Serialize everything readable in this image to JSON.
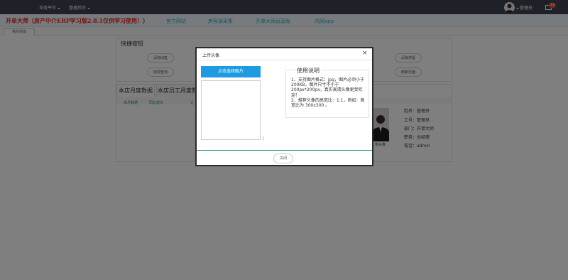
{
  "topbar": {
    "menu": [
      {
        "label": "业务平台"
      },
      {
        "label": "管理后台"
      }
    ],
    "user_name": "管理员",
    "mail_badge": "11"
  },
  "header": {
    "brand": "开单大师（房产中介ERP学习版2.8.1仅供学习使用！）",
    "links": [
      {
        "label": "官方网站"
      },
      {
        "label": "房客源采集"
      },
      {
        "label": "开单大师运营版"
      },
      {
        "label": "内网app"
      }
    ]
  },
  "tabs": {
    "active": "我的桌面"
  },
  "dashboard": {
    "quick_title": "快捷按钮",
    "quick_buttons": [
      {
        "label": "添加出售"
      },
      {
        "label": "房源查询"
      },
      {
        "label": "添加求租"
      },
      {
        "label": "刷新页面"
      }
    ],
    "data_tabs": [
      {
        "label": "本店月度数据"
      },
      {
        "label": "本店员工月度数"
      }
    ],
    "columns": [
      {
        "label": "本月数据"
      },
      {
        "label": "同比增长"
      },
      {
        "label": "让"
      }
    ],
    "profile": {
      "photo_label": "上传头像",
      "fields": [
        {
          "label": "姓名：管理员"
        },
        {
          "label": "工号：管理员"
        },
        {
          "label": "部门：开单大师"
        },
        {
          "label": "职务：总经理"
        },
        {
          "label": "电话：admin"
        }
      ]
    }
  },
  "modal": {
    "title": "上传头像",
    "close_symbol": "×",
    "choose_button": "点击选择图片",
    "tick_mark": "|",
    "help_title": "使用说明",
    "help_line1": "1、支持图片格式：jpg，图片必须小于200KB，图片尺寸不小于200px*200px，真实高清头像更受欢迎！",
    "help_line2": "2、推荐头像的高宽比：1:1，例如：高宽比为 300x300 。",
    "close_button": "关闭"
  },
  "colors": {
    "topbar": "#3e4352",
    "brand": "#e8231f",
    "nav_link": "#35a7c8",
    "primary_button": "#1e9be0",
    "accent_green": "#1e9b6a"
  }
}
